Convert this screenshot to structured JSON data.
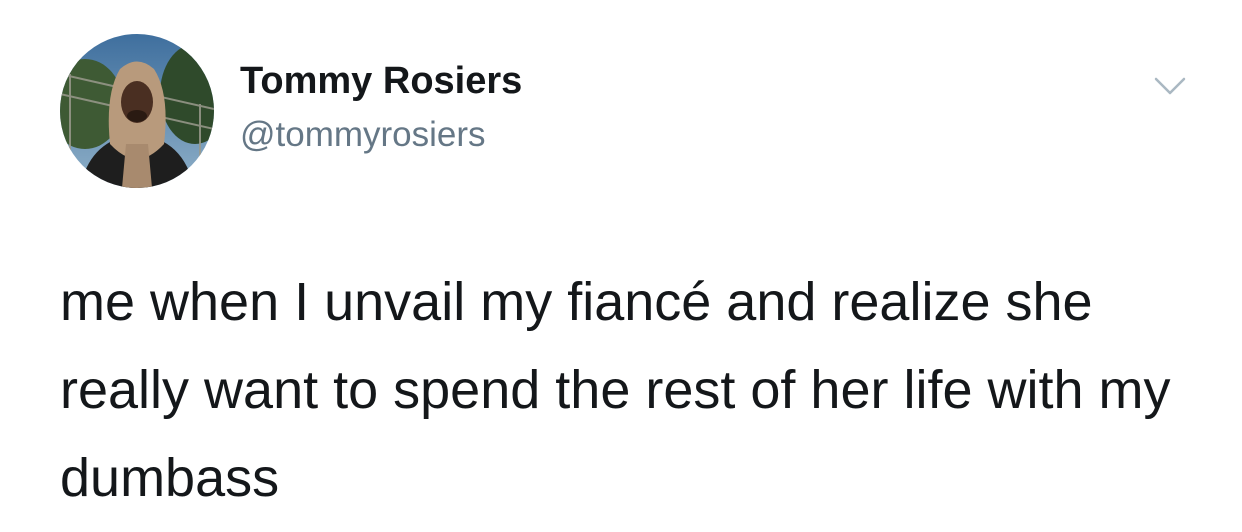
{
  "tweet": {
    "author": {
      "display_name": "Tommy Rosiers",
      "handle": "@tommyrosiers"
    },
    "text": "me when I unvail my fiancé and realize she really want to spend the rest of her life with my dumbass",
    "menu_icon": "chevron-down-icon"
  },
  "colors": {
    "text": "#14171a",
    "secondary_text": "#657786",
    "chevron": "#aab8c2",
    "background": "#ffffff"
  }
}
